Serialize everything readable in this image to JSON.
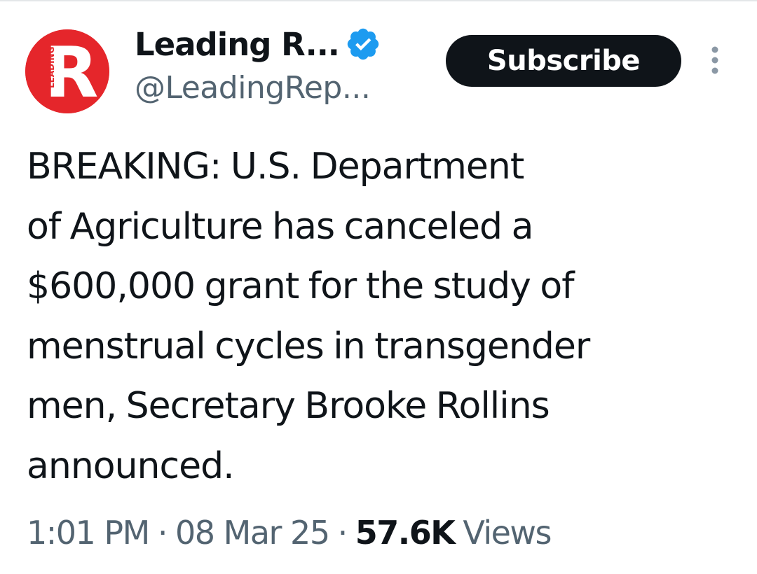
{
  "author": {
    "display_name": "Leading R...",
    "handle": "@LeadingRep...",
    "verified": true,
    "avatar": {
      "letter": "R",
      "side_text": "LEADING",
      "color": "#e5262b"
    },
    "subscribe_label": "Subscribe"
  },
  "tweet": {
    "text": "BREAKING: U.S. Department\nof Agriculture has canceled a\n$600,000 grant for the study of\nmenstrual cycles in transgender\nmen, Secretary Brooke Rollins\nannounced."
  },
  "meta": {
    "time": "1:01 PM",
    "separator": "·",
    "date": "08 Mar 25",
    "views_count": "57.6K",
    "views_label": "Views"
  },
  "icons": {
    "verified": "verified-badge-icon",
    "more": "more-vertical-icon"
  },
  "colors": {
    "accent_blue": "#1d9bf0",
    "text_primary": "#0f1419",
    "text_secondary": "#536471",
    "button_bg": "#0f1419",
    "avatar_red": "#e5262b"
  }
}
